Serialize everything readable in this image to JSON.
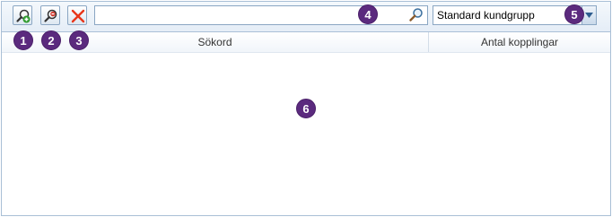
{
  "toolbar": {
    "add_keyword_icon": "magnifier-plus-icon",
    "remove_keyword_icon": "magnifier-minus-icon",
    "delete_icon": "red-x-icon"
  },
  "search": {
    "value": "",
    "placeholder": "",
    "icon": "magnifier-icon"
  },
  "customer_group": {
    "selected": "Standard kundgrupp"
  },
  "grid": {
    "columns": [
      "Sökord",
      "Antal kopplingar"
    ],
    "rows": []
  },
  "callouts": [
    "1",
    "2",
    "3",
    "4",
    "5",
    "6"
  ],
  "colors": {
    "callout_bg": "#5b2a7e",
    "delete_red": "#e8361a",
    "border": "#8aa6c3"
  }
}
